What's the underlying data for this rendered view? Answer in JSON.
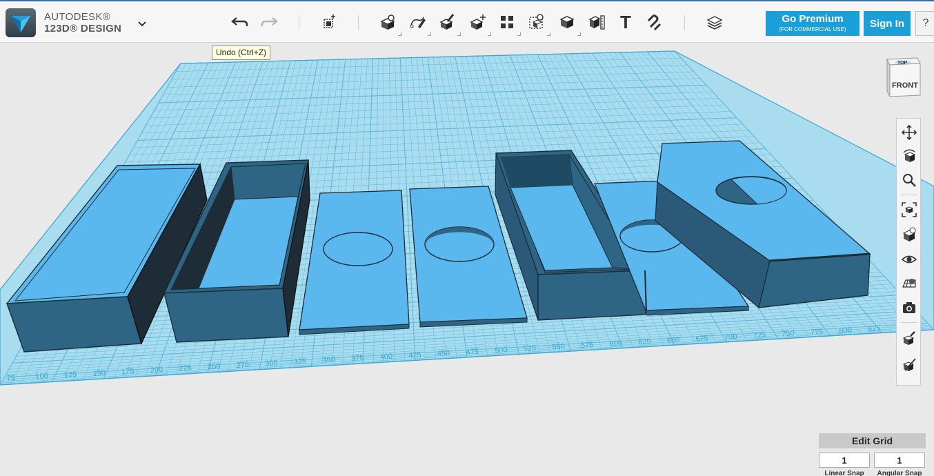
{
  "app": {
    "brand_line1": "AUTODESK®",
    "brand_line2": "123D® DESIGN"
  },
  "toolbar": {
    "undo_tooltip": "Undo (Ctrl+Z)",
    "text_tool_glyph": "T",
    "buttons": [
      "undo",
      "redo",
      "transform",
      "primitives",
      "sketch",
      "construct",
      "modify",
      "pattern",
      "grouping",
      "combine",
      "measure",
      "text",
      "snap",
      "material"
    ]
  },
  "account": {
    "premium_label": "Go Premium",
    "premium_sub": "(FOR COMMERCIAL USE)",
    "signin_label": "Sign In",
    "help_label": "?"
  },
  "viewcube": {
    "top": "TOP",
    "front": "FRONT"
  },
  "grid": {
    "edit_label": "Edit Grid",
    "linear_value": "1",
    "angular_value": "1",
    "linear_label": "Linear Snap",
    "angular_label": "Angular Snap",
    "ruler_labels": [
      "75",
      "100",
      "125",
      "150",
      "175",
      "200",
      "225",
      "250",
      "275",
      "300",
      "325",
      "350",
      "375",
      "400",
      "425",
      "450",
      "475",
      "500",
      "525",
      "550",
      "575",
      "600",
      "625",
      "650",
      "675",
      "700",
      "725",
      "750",
      "775",
      "800",
      "825",
      "850"
    ]
  },
  "colors": {
    "accent": "#1a9fd8",
    "grid": "#9fd6ea",
    "grid_line": "#56b9dc",
    "model_top": "#5ab8ee",
    "model_side": "#2f6584",
    "model_dark": "#1d2c37"
  }
}
